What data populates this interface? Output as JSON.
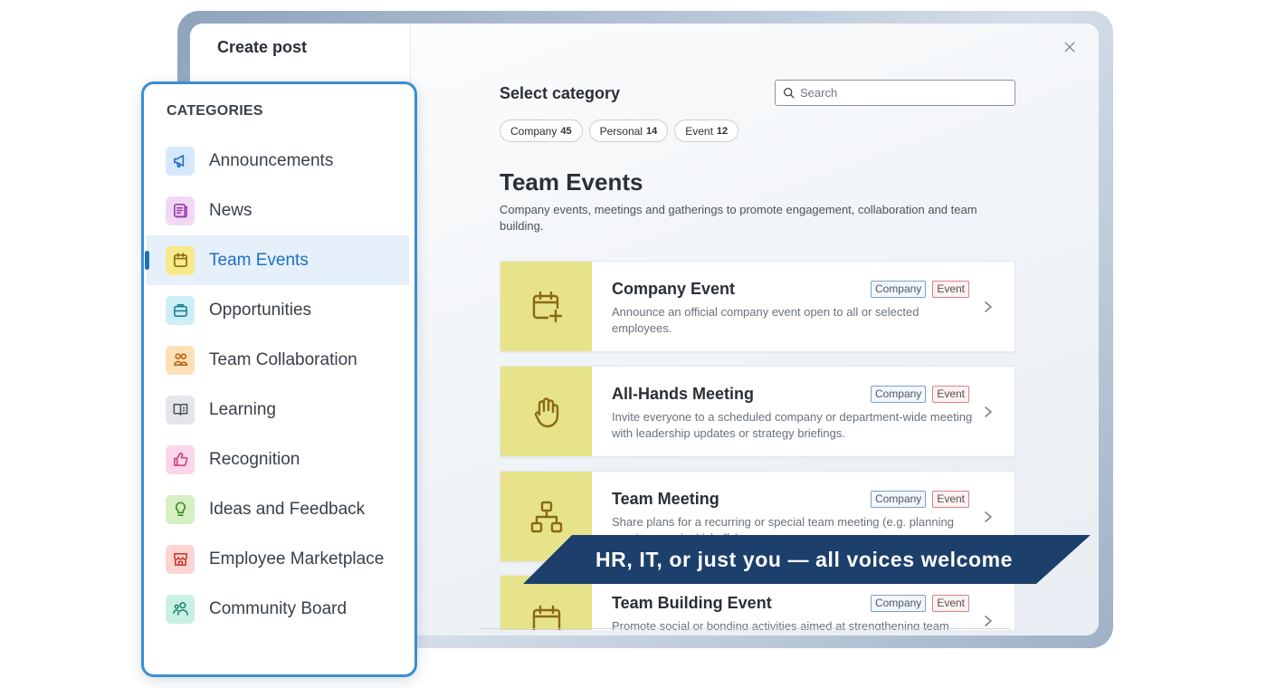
{
  "window": {
    "title": "Create post",
    "close_icon": "close-icon"
  },
  "main": {
    "select_title": "Select category",
    "search": {
      "placeholder": "Search",
      "value": ""
    },
    "filters": [
      {
        "label": "Company",
        "count": "45"
      },
      {
        "label": "Personal",
        "count": "14"
      },
      {
        "label": "Event",
        "count": "12"
      }
    ],
    "section": {
      "title": "Team Events",
      "description": "Company events, meetings and gatherings to promote engagement, collaboration and team building."
    },
    "cards": [
      {
        "title": "Company Event",
        "description": "Announce an official company event open to all or selected employees.",
        "tags": [
          "Company",
          "Event"
        ],
        "icon": "calendar-plus-icon"
      },
      {
        "title": "All-Hands Meeting",
        "description": "Invite everyone to a scheduled company or department-wide meeting with leadership updates or strategy briefings.",
        "tags": [
          "Company",
          "Event"
        ],
        "icon": "raised-hand-icon"
      },
      {
        "title": "Team Meeting",
        "description": "Share plans for a recurring or special team meeting (e.g. planning sessions, sprint kickoffs).",
        "tags": [
          "Company",
          "Event"
        ],
        "icon": "org-chart-icon"
      },
      {
        "title": "Team Building Event",
        "description": "Promote social or bonding activities aimed at strengthening team relationships.",
        "tags": [
          "Company",
          "Event"
        ],
        "icon": "calendar-icon"
      }
    ]
  },
  "categories": {
    "heading": "CATEGORIES",
    "items": [
      {
        "label": "Announcements",
        "icon": "megaphone-icon",
        "bg": "#d6e8fb",
        "fg": "#1f6fc4"
      },
      {
        "label": "News",
        "icon": "newspaper-icon",
        "bg": "#f1d9f5",
        "fg": "#9b37b0"
      },
      {
        "label": "Team Events",
        "icon": "calendar-icon",
        "bg": "#f7e98c",
        "fg": "#8a6a10",
        "active": true
      },
      {
        "label": "Opportunities",
        "icon": "briefcase-icon",
        "bg": "#cdeef6",
        "fg": "#1f7f9a"
      },
      {
        "label": "Team Collaboration",
        "icon": "people-icon",
        "bg": "#fde0b8",
        "fg": "#c2630d"
      },
      {
        "label": "Learning",
        "icon": "book-icon",
        "bg": "#e3e5e8",
        "fg": "#4d535b"
      },
      {
        "label": "Recognition",
        "icon": "thumbs-up-icon",
        "bg": "#fbd6e8",
        "fg": "#c23a7b"
      },
      {
        "label": "Ideas and Feedback",
        "icon": "lightbulb-icon",
        "bg": "#d5f0c4",
        "fg": "#3f8a1c"
      },
      {
        "label": "Employee Marketplace",
        "icon": "storefront-icon",
        "bg": "#fcd5d2",
        "fg": "#c8322a"
      },
      {
        "label": "Community Board",
        "icon": "community-icon",
        "bg": "#c9f0e3",
        "fg": "#17886a"
      }
    ]
  },
  "banner": {
    "text": "HR, IT, or just you — all voices welcome"
  },
  "colors": {
    "accent": "#1f6fc4",
    "banner_bg": "#1c3f6c",
    "card_thumb": "#e7e38a"
  }
}
